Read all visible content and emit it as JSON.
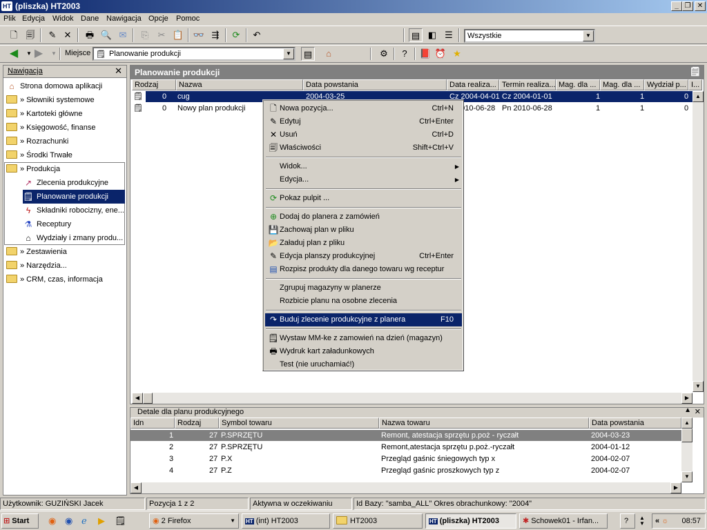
{
  "window": {
    "title": "(pliszka) HT2003",
    "app_icon": "HT"
  },
  "menu": [
    "Plik",
    "Edycja",
    "Widok",
    "Dane",
    "Nawigacja",
    "Opcje",
    "Pomoc"
  ],
  "toolbar": {
    "filter_value": "Wszystkie",
    "place_label": "Miejsce",
    "place_value": "Planowanie produkcji"
  },
  "nav": {
    "title": "Nawigacja",
    "items": [
      {
        "label": "Strona domowa aplikacji"
      },
      {
        "label": "» Słowniki systemowe"
      },
      {
        "label": "» Kartoteki główne"
      },
      {
        "label": "» Księgowość, finanse"
      },
      {
        "label": "» Rozrachunki"
      },
      {
        "label": "» Środki Trwałe"
      },
      {
        "label": "» Produkcja"
      },
      {
        "label": "Zlecenia produkcyjne"
      },
      {
        "label": "Planowanie produkcji"
      },
      {
        "label": "Składniki robocizny, ene..."
      },
      {
        "label": "Receptury"
      },
      {
        "label": "Wydziały i zmany produ..."
      },
      {
        "label": "» Zestawienia"
      },
      {
        "label": "» Narzędzia..."
      },
      {
        "label": "» CRM, czas, informacja"
      }
    ]
  },
  "main": {
    "title": "Planowanie produkcji",
    "columns": [
      "Rodzaj",
      "Nazwa",
      "Data powstania",
      "Data realiza...",
      "Termin realiza...",
      "Mag. dla ...",
      "Mag. dla ...",
      "Wydział p...",
      "I..."
    ],
    "rows": [
      {
        "rodzaj": "0",
        "nazwa": "cug",
        "data_powstania": "2004-03-25",
        "data_realizacji": "Cz 2004-04-01",
        "termin": "Cz 2004-01-01",
        "mag1": "1",
        "mag2": "1",
        "wydzial": "0"
      },
      {
        "rodzaj": "0",
        "nazwa": "Nowy plan produkcji",
        "data_powstania": "",
        "data_realizacji": "2010-06-28",
        "termin": "Pn 2010-06-28",
        "mag1": "1",
        "mag2": "1",
        "wydzial": "0"
      }
    ]
  },
  "context_menu": {
    "items": [
      {
        "label": "Nowa pozycja...",
        "shortcut": "Ctrl+N",
        "icon": "new-doc-icon"
      },
      {
        "label": "Edytuj",
        "shortcut": "Ctrl+Enter",
        "icon": "edit-icon"
      },
      {
        "label": "Usuń",
        "shortcut": "Ctrl+D",
        "icon": "delete-x-icon"
      },
      {
        "label": "Właściwości",
        "shortcut": "Shift+Ctrl+V",
        "icon": "properties-icon"
      },
      {
        "label": "Widok...",
        "shortcut": "▶"
      },
      {
        "label": "Edycja...",
        "shortcut": "▶"
      },
      {
        "label": "Pokaz pulpit ...",
        "shortcut": "",
        "icon": "desktop-icon"
      },
      {
        "label": "Dodaj do planera z zamówień",
        "shortcut": "",
        "icon": "add-icon"
      },
      {
        "label": "Zachowaj plan w pliku",
        "shortcut": "",
        "icon": "save-icon"
      },
      {
        "label": "Załaduj plan z pliku",
        "shortcut": "",
        "icon": "open-folder-icon"
      },
      {
        "label": "Edycja planszy produkcyjnej",
        "shortcut": "Ctrl+Enter",
        "icon": "edit-board-icon"
      },
      {
        "label": "Rozpisz produkty dla danego towaru wg receptur",
        "shortcut": "",
        "icon": "list-icon"
      },
      {
        "label": "Zgrupuj magazyny w planerze",
        "shortcut": ""
      },
      {
        "label": "Rozbicie planu na osobne zlecenia",
        "shortcut": ""
      },
      {
        "label": "Buduj zlecenie produkcyjne z planera",
        "shortcut": "F10",
        "icon": "build-icon"
      },
      {
        "label": "Wystaw MM-ke z zamowień na dzień (magazyn)",
        "shortcut": "",
        "icon": "document-icon"
      },
      {
        "label": "Wydruk kart załadunkowych",
        "shortcut": "",
        "icon": "printer-icon"
      },
      {
        "label": "Test (nie uruchamiać!)",
        "shortcut": ""
      }
    ]
  },
  "details": {
    "title": "Detale dla planu produkcyjnego",
    "columns": [
      "Idn",
      "Rodzaj",
      "Symbol towaru",
      "Nazwa towaru",
      "Data powstania"
    ],
    "rows": [
      {
        "idn": "1",
        "rodzaj": "27",
        "symbol": "P.SPRZĘTU",
        "nazwa": "Remont, atestacja sprzętu p.poż - ryczałt",
        "data": "2004-03-23"
      },
      {
        "idn": "2",
        "rodzaj": "27",
        "symbol": "P.SPRZĘTU",
        "nazwa": "Remont,atestacja sprzętu p.poż.-ryczałt",
        "data": "2004-01-12"
      },
      {
        "idn": "3",
        "rodzaj": "27",
        "symbol": "P.X",
        "nazwa": "Przegląd gaśnic śniegowych typ x",
        "data": "2004-02-07"
      },
      {
        "idn": "4",
        "rodzaj": "27",
        "symbol": "P.Z",
        "nazwa": "Przegląd gaśnic proszkowych typ z",
        "data": "2004-02-07"
      }
    ]
  },
  "status": {
    "user": "Użytkownik: GUZIŃSKI Jacek",
    "position": "Pozycja 1 z 2",
    "state": "Aktywna w oczekiwaniu",
    "db": "Id Bazy: \"samba_ALL\" Okres obrachunkowy: \"2004\""
  },
  "taskbar": {
    "start": "Start",
    "tasks": [
      "2 Firefox",
      "(int) HT2003",
      "HT2003",
      "(pliszka) HT2003",
      "Schowek01 - Irfan..."
    ],
    "clock": "08:57"
  }
}
